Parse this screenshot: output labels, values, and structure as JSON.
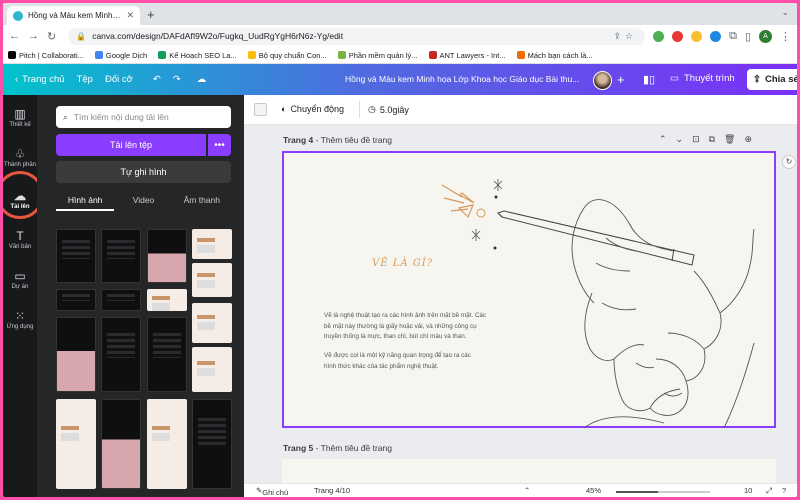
{
  "browser": {
    "tab_title": "Hồng và Màu kem Minh họa Lớp",
    "url": "canva.com/design/DAFdAfI9W2o/Fugkq_UudRgYgH6rN6z-Yg/edit",
    "profile_initial": "A",
    "bookmarks": [
      "Pitch | Collaborati...",
      "Google Dịch",
      "Kế Hoạch SEO La...",
      "Bộ quy chuẩn Con...",
      "Phần mềm quản lý...",
      "ANT Lawyers - Int...",
      "Mách bạn cách là..."
    ]
  },
  "canva_header": {
    "home": "Trang chủ",
    "file": "Tệp",
    "resize": "Đổi cỡ",
    "doc_title": "Hồng và Màu kem Minh họa Lớp Khoa học Giáo dục Bài thu...",
    "present": "Thuyết trình",
    "share": "Chia sẻ"
  },
  "rail": [
    {
      "label": "Thiết kế",
      "icon": "layout-icon",
      "glyph": "▥"
    },
    {
      "label": "Thành phần",
      "icon": "elements-icon",
      "glyph": "♧"
    },
    {
      "label": "Tải lên",
      "icon": "cloud-upload-icon",
      "glyph": "☁"
    },
    {
      "label": "Văn bản",
      "icon": "text-icon",
      "glyph": "T"
    },
    {
      "label": "Dự án",
      "icon": "folder-icon",
      "glyph": "▭"
    },
    {
      "label": "Ứng dụng",
      "icon": "apps-icon",
      "glyph": "⁙"
    }
  ],
  "panel": {
    "search_placeholder": "Tìm kiếm nội dung tải lên",
    "upload_button": "Tải lên tệp",
    "record_button": "Tự ghi hình",
    "tabs": [
      "Hình ảnh",
      "Video",
      "Âm thanh"
    ],
    "active_tab": "Hình ảnh"
  },
  "toolbar": {
    "animate": "Chuyển động",
    "duration": "5.0giây"
  },
  "pages": {
    "page4_label": "Trang 4",
    "page4_title": "Thêm tiêu đề trang",
    "page5_label": "Trang 5",
    "page5_title": "Thêm tiêu đề trang"
  },
  "slide": {
    "heading": "VẼ LÀ GÌ?",
    "para1_lines": [
      "Vẽ là nghệ thuật tạo ra các hình ảnh trên mặt bề mặt. Các",
      "bề mặt này thường là giấy hoặc vải, và những công cụ",
      "truyền thống là mực, than chì, bút chì màu và than."
    ],
    "para2_lines": [
      "Vẽ được coi là một kỹ năng quan trọng để tạo ra các",
      "hình thức khác của tác phẩm nghệ thuật."
    ],
    "accent_color": "#d49a5b"
  },
  "bottom_bar": {
    "notes": "Ghi chú",
    "page_indicator": "Trang 4/10",
    "zoom": "45%",
    "zoom_fraction": 0.45,
    "grid_count": "10"
  },
  "colors": {
    "canva_purple": "#8b3dff",
    "header_gradient_start": "#00c4cc",
    "header_gradient_end": "#7b2ff7",
    "highlight_ring": "#e4573d",
    "frame_border": "#ff4fa8"
  }
}
